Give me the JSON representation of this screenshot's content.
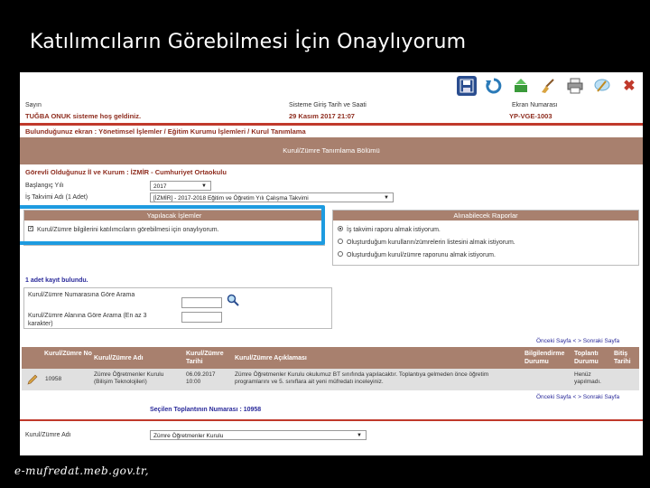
{
  "slide": {
    "title": "Katılımcıların Görebilmesi İçin Onaylıyorum",
    "footer": "e-mufredat.meb.gov.tr,"
  },
  "toolbar": {
    "icons": [
      "save-icon",
      "refresh-icon",
      "export-icon",
      "clear-icon",
      "print-icon",
      "edit-icon",
      "close-icon"
    ],
    "close_glyph": "✖"
  },
  "header": {
    "greeting_label": "Sayın",
    "welcome": "TUĞBA ONUK sisteme hoş geldiniz.",
    "login_label": "Sisteme Giriş Tarih ve Saati",
    "login_value": "29 Kasım 2017 21:07",
    "screen_no_label": "Ekran Numarası",
    "screen_no_value": "YP-VGE-1003",
    "breadcrumb": "Bulunduğunuz ekran : Yönetimsel İşlemler / Eğitim Kurumu İşlemleri / Kurul Tanımlama"
  },
  "section": {
    "title": "Kurul/Zümre Tanımlama Bölümü",
    "duty": "Görevli Olduğunuz İl ve Kurum : İZMİR - Cumhuriyet Ortaokulu"
  },
  "form": {
    "start_year_label": "Başlangıç Yılı",
    "start_year_value": "2017",
    "calendar_label": "İş Takvimi Adı (1 Adet)",
    "calendar_value": "[İZMİR] - 2017-2018 Eğitim ve Öğretim Yılı Çalışma Takvimi"
  },
  "actions_panel": {
    "title": "Yapılacak İşlemler",
    "checkbox_label": "Kurul/Zümre bilgilerini katılımcıların görebilmesi için onaylıyorum.",
    "checkbox_mark": "✓"
  },
  "reports_panel": {
    "title": "Alınabilecek Raporlar",
    "options": [
      "İş takvimi raporu almak istiyorum.",
      "Oluşturduğum kurulların/zümrelerin listesini almak istiyorum.",
      "Oluşturduğum kurul/zümre raporunu almak istiyorum."
    ]
  },
  "search": {
    "found": "1 adet kayıt bulundu.",
    "by_number_label": "Kurul/Zümre Numarasına Göre Arama",
    "by_field_label": "Kurul/Zümre Alanına Göre Arama (En az 3 karakter)"
  },
  "pager": {
    "prev": "Önceki Sayfa",
    "lt": "<",
    "gt": ">",
    "next": "Sonraki Sayfa"
  },
  "table": {
    "headers": {
      "no": "Kurul/Zümre No",
      "name": "Kurul/Zümre Adı",
      "date": "Kurul/Zümre Tarihi",
      "desc": "Kurul/Zümre Açıklaması",
      "info": "Bilgilendirme Durumu",
      "meeting": "Toplantı Durumu",
      "end": "Bitiş Tarihi"
    },
    "row": {
      "no": "10958",
      "name": "Zümre Öğretmenler Kurulu (Bilişim Teknolojileri)",
      "date": "06.09.2017 10:00",
      "desc": "Zümre Öğretmenler Kurulu okulumuz BT sınıfında yapılacaktır. Toplantıya gelmeden önce öğretim programlarını ve 5. sınıflara ait yeni müfredatı inceleyiniz.",
      "meeting": "Henüz yapılmadı."
    }
  },
  "selected": {
    "meeting_no": "Seçilen Toplantının Numarası : 10958",
    "field_label": "Kurul/Zümre Adı",
    "field_value": "Zümre Öğretmenler Kurulu"
  },
  "colors": {
    "accent": "#a8806e",
    "highlight": "#1d9be0",
    "title_red": "#8e2c1e"
  }
}
